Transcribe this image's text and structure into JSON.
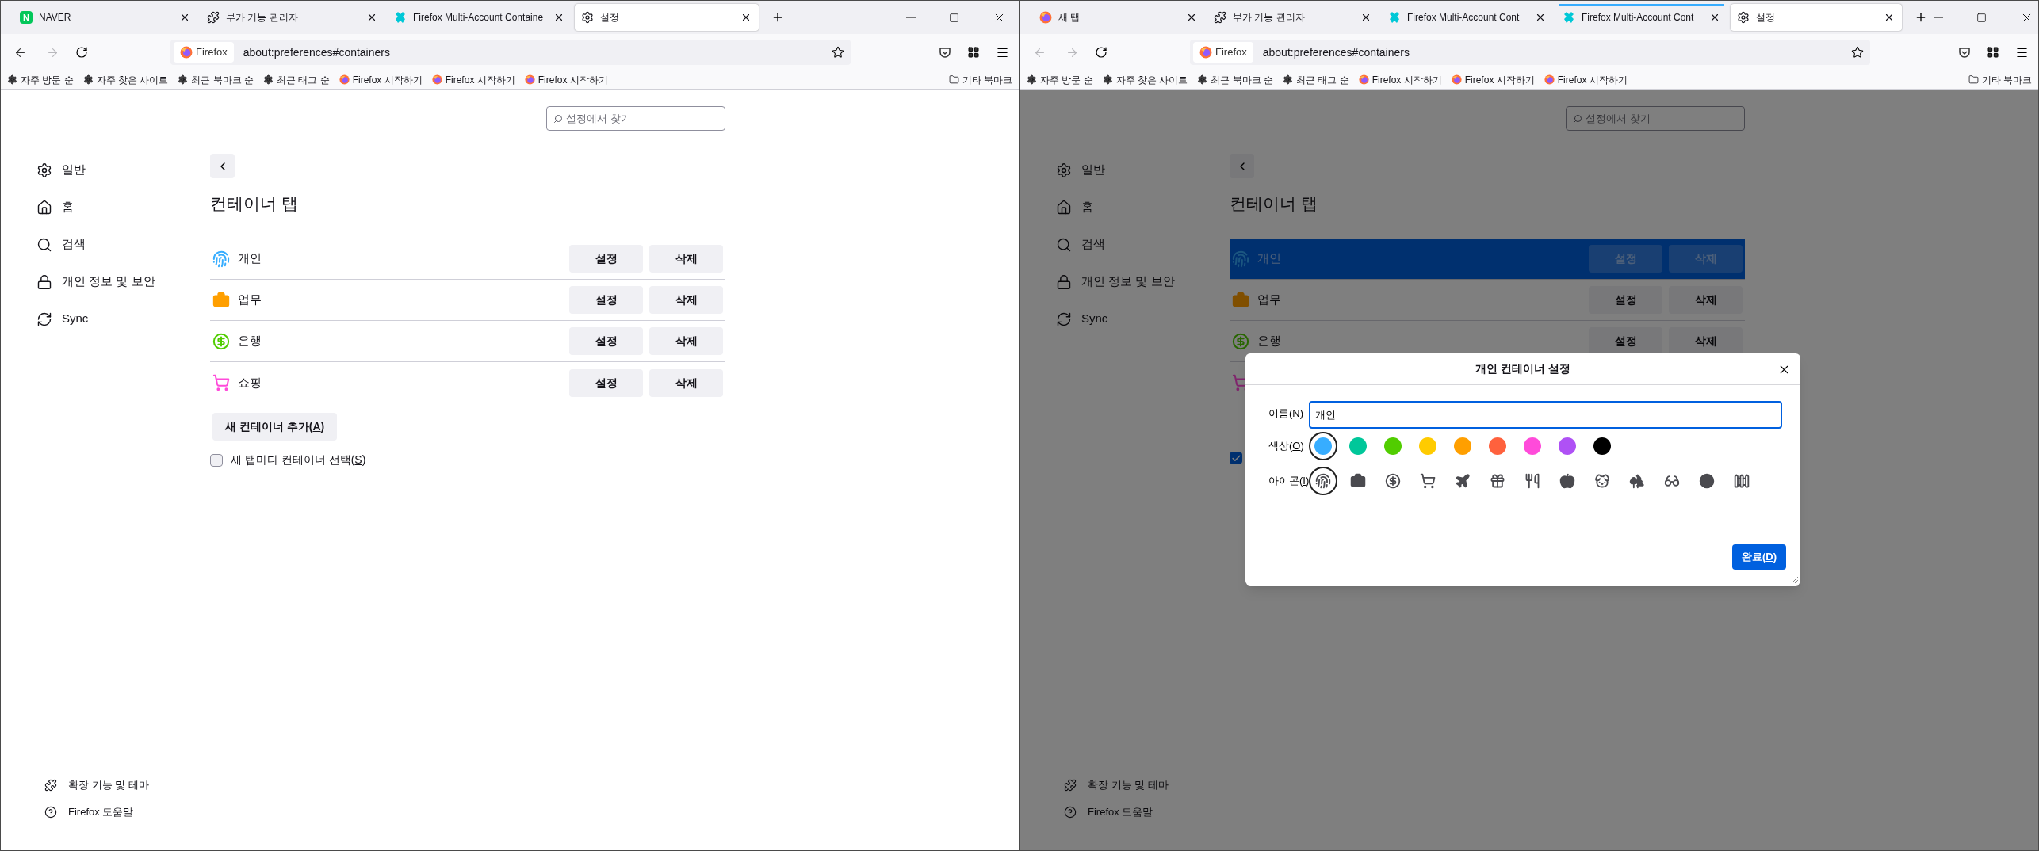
{
  "windows": [
    {
      "tabs": [
        {
          "label": "NAVER",
          "kind": "letter",
          "icon_text": "N",
          "selected": false,
          "container_line": false
        },
        {
          "label": "부가 기능 관리자",
          "kind": "puzzle",
          "selected": false,
          "container_line": false
        },
        {
          "label": "Firefox Multi-Account Containe",
          "kind": "containers",
          "selected": false,
          "container_line": false
        },
        {
          "label": "설정",
          "kind": "gear",
          "selected": true,
          "container_line": false
        }
      ],
      "nav": {
        "back_disabled": false,
        "forward_disabled": true,
        "identity": "Firefox",
        "url": "about:preferences#containers"
      },
      "bookmarks": [
        {
          "label": "자주 방문 순",
          "kind": "gear"
        },
        {
          "label": "자주 찾은 사이트",
          "kind": "gear"
        },
        {
          "label": "최근 북마크 순",
          "kind": "gear"
        },
        {
          "label": "최근 태그 순",
          "kind": "gear"
        },
        {
          "label": "Firefox 시작하기",
          "kind": "firefox"
        },
        {
          "label": "Firefox 시작하기",
          "kind": "firefox"
        },
        {
          "label": "Firefox 시작하기",
          "kind": "firefox"
        }
      ],
      "other_bookmarks": "기타 북마크",
      "search": {
        "placeholder": "설정에서 찾기"
      },
      "sidebar": {
        "items": [
          {
            "label": "일반",
            "kind": "gear"
          },
          {
            "label": "홈",
            "kind": "home"
          },
          {
            "label": "검색",
            "kind": "search"
          },
          {
            "label": "개인 정보 및 보안",
            "kind": "lock"
          },
          {
            "label": "Sync",
            "kind": "sync"
          }
        ],
        "footer": [
          {
            "label": "확장 기능 및 테마",
            "kind": "puzzle"
          },
          {
            "label": "Firefox 도움말",
            "kind": "help"
          }
        ]
      },
      "heading": "컨테이너 탭",
      "containers": [
        {
          "name": "개인",
          "kind": "fingerprint",
          "color": "#37adff",
          "selected": false,
          "buttons": [
            "설정",
            "삭제"
          ]
        },
        {
          "name": "업무",
          "kind": "briefcase",
          "color": "#ff9f00",
          "selected": false,
          "buttons": [
            "설정",
            "삭제"
          ]
        },
        {
          "name": "은행",
          "kind": "dollar",
          "color": "#51cd00",
          "selected": false,
          "buttons": [
            "설정",
            "삭제"
          ]
        },
        {
          "name": "쇼핑",
          "kind": "cart",
          "color": "#ff4bda",
          "selected": false,
          "buttons": [
            "설정",
            "삭제"
          ]
        }
      ],
      "add_button": {
        "label": "새 컨테이너 추가(",
        "accesskey": "A",
        "label_end": ")"
      },
      "checkbox": {
        "label": "새 탭마다 컨테이너 선택(",
        "accesskey": "S",
        "label_end": ")",
        "checked": false
      }
    },
    {
      "tabs": [
        {
          "label": "새 탭",
          "kind": "firefox",
          "selected": false,
          "container_line": false
        },
        {
          "label": "부가 기능 관리자",
          "kind": "puzzle",
          "selected": false,
          "container_line": false
        },
        {
          "label": "Firefox Multi-Account Cont",
          "kind": "containers",
          "selected": false,
          "container_line": false
        },
        {
          "label": "Firefox Multi-Account Cont",
          "kind": "containers",
          "selected": false,
          "container_line": true
        },
        {
          "label": "설정",
          "kind": "gear",
          "selected": true,
          "container_line": false
        }
      ],
      "nav": {
        "back_disabled": true,
        "forward_disabled": true,
        "identity": "Firefox",
        "url": "about:preferences#containers"
      },
      "bookmarks": [
        {
          "label": "자주 방문 순",
          "kind": "gear"
        },
        {
          "label": "자주 찾은 사이트",
          "kind": "gear"
        },
        {
          "label": "최근 북마크 순",
          "kind": "gear"
        },
        {
          "label": "최근 태그 순",
          "kind": "gear"
        },
        {
          "label": "Firefox 시작하기",
          "kind": "firefox"
        },
        {
          "label": "Firefox 시작하기",
          "kind": "firefox"
        },
        {
          "label": "Firefox 시작하기",
          "kind": "firefox"
        }
      ],
      "other_bookmarks": "기타 북마크",
      "search": {
        "placeholder": "설정에서 찾기"
      },
      "sidebar": {
        "items": [
          {
            "label": "일반",
            "kind": "gear"
          },
          {
            "label": "홈",
            "kind": "home"
          },
          {
            "label": "검색",
            "kind": "search"
          },
          {
            "label": "개인 정보 및 보안",
            "kind": "lock"
          },
          {
            "label": "Sync",
            "kind": "sync"
          }
        ],
        "footer": [
          {
            "label": "확장 기능 및 테마",
            "kind": "puzzle"
          },
          {
            "label": "Firefox 도움말",
            "kind": "help"
          }
        ]
      },
      "heading": "컨테이너 탭",
      "containers": [
        {
          "name": "개인",
          "kind": "fingerprint",
          "color": "#1b5680",
          "selected": true,
          "buttons": [
            "설정",
            "삭제"
          ]
        },
        {
          "name": "업무",
          "kind": "briefcase",
          "color": "#804f00",
          "selected": false,
          "buttons": [
            "설정",
            "삭제"
          ]
        },
        {
          "name": "은행",
          "kind": "dollar",
          "color": "#286600",
          "selected": false,
          "buttons": [
            "설정",
            "삭제"
          ]
        },
        {
          "kind": "cart",
          "color": "#80256d",
          "selected": false
        }
      ],
      "checkbox": {
        "checked": true
      },
      "dialog": {
        "title": "개인 컨테이너 설정",
        "name_label": {
          "label": "이름(",
          "accesskey": "N",
          "label_end": ")"
        },
        "name_value": "개인",
        "color_label": {
          "label": "색상(",
          "accesskey": "O",
          "label_end": ")"
        },
        "colors": [
          {
            "color": "#37adff",
            "selected": true
          },
          {
            "color": "#00c79a",
            "selected": false
          },
          {
            "color": "#51cd00",
            "selected": false
          },
          {
            "color": "#ffcb00",
            "selected": false
          },
          {
            "color": "#ff9f00",
            "selected": false
          },
          {
            "color": "#ff613d",
            "selected": false
          },
          {
            "color": "#ff4bda",
            "selected": false
          },
          {
            "color": "#af51f5",
            "selected": false
          },
          {
            "color": "#000000",
            "selected": false
          }
        ],
        "icon_label": {
          "label": "아이콘(",
          "accesskey": "I",
          "label_end": ")"
        },
        "icons": [
          {
            "kind": "fingerprint",
            "selected": true
          },
          {
            "kind": "briefcase",
            "selected": false
          },
          {
            "kind": "dollar",
            "selected": false
          },
          {
            "kind": "cart",
            "selected": false
          },
          {
            "kind": "plane",
            "selected": false
          },
          {
            "kind": "gift",
            "selected": false
          },
          {
            "kind": "food",
            "selected": false
          },
          {
            "kind": "fruit",
            "selected": false
          },
          {
            "kind": "pet",
            "selected": false
          },
          {
            "kind": "tree",
            "selected": false
          },
          {
            "kind": "glasses",
            "selected": false
          },
          {
            "kind": "circle",
            "selected": false
          },
          {
            "kind": "fence",
            "selected": false
          }
        ],
        "done_button": {
          "label": "완료(",
          "accesskey": "D",
          "label_end": ")"
        }
      }
    }
  ]
}
